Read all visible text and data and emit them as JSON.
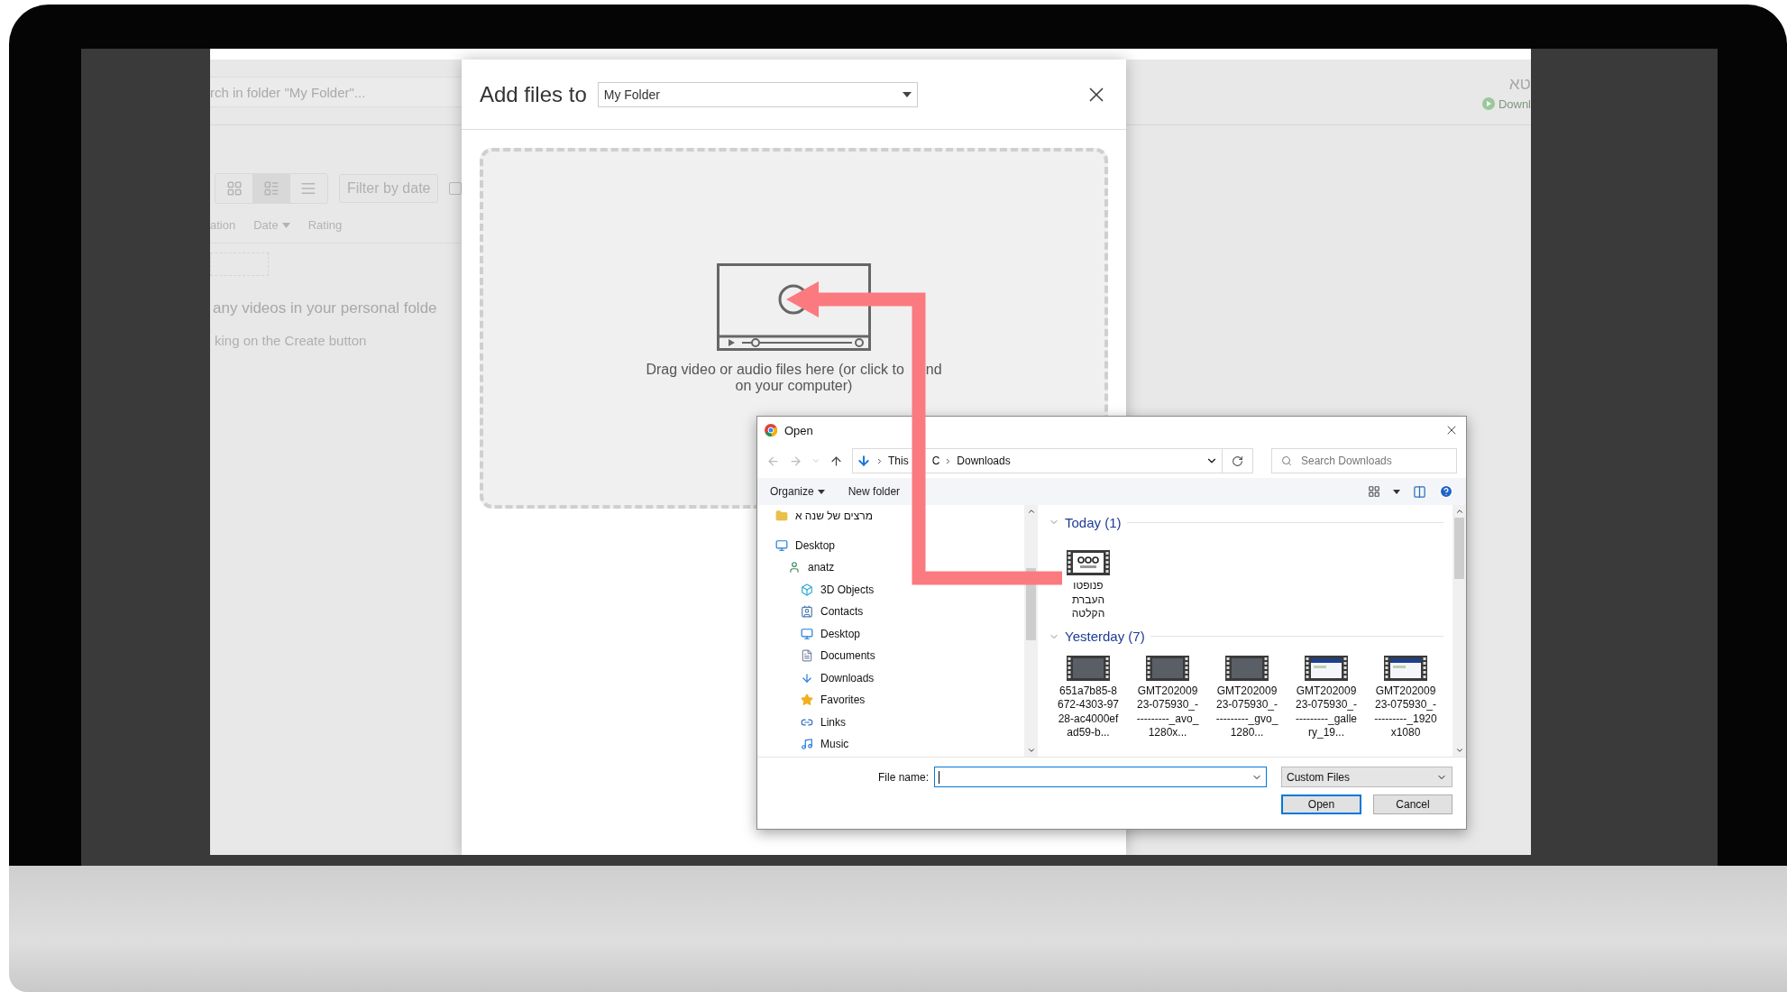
{
  "background_app": {
    "search": {
      "placeholder": "rch in folder \"My Folder\"..."
    },
    "view_buttons": [
      {
        "selected": false
      },
      {
        "selected": true
      },
      {
        "selected": false
      }
    ],
    "filter_button": "Filter by date",
    "checkbox": {
      "checked": false
    },
    "columns": [
      {
        "label": "ation",
        "sorted": false
      },
      {
        "label": "Date",
        "sorted": true
      },
      {
        "label": "Rating",
        "sorted": false
      }
    ],
    "empty_message": "any videos in your personal folde",
    "empty_hint": "king on the Create button",
    "user_name": "טא",
    "download_link": "Downl"
  },
  "add_files_modal": {
    "title": "Add files to",
    "folder_select": "My Folder",
    "dropzone": {
      "line_1_parts": [
        "Drag video or audio files here (or click to",
        "nd"
      ],
      "line_2": "on your computer)"
    }
  },
  "open_dialog": {
    "title": "Open",
    "breadcrumb": [
      [
        "This",
        "C"
      ],
      [
        "Downloads"
      ]
    ],
    "search": {
      "placeholder": "Search Downloads"
    },
    "toolbar": [
      {
        "label": "Organize",
        "menu": true
      },
      {
        "label": "New folder",
        "menu": false
      }
    ],
    "nav_tree": [
      {
        "label": "מרצים של שנה א"
      },
      {
        "label": "Desktop",
        "children": [
          {
            "label": "anatz",
            "children": [
              {
                "label": "3D Objects"
              },
              {
                "label": "Contacts"
              },
              {
                "label": "Desktop"
              },
              {
                "label": "Documents"
              },
              {
                "label": "Downloads"
              },
              {
                "label": "Favorites"
              },
              {
                "label": "Links"
              },
              {
                "label": "Music"
              }
            ]
          }
        ]
      }
    ],
    "groups": [
      {
        "label": "Today (1)",
        "files": [
          {
            "name": "פנופטו העברת הקלטה",
            "kind": "logo"
          }
        ]
      },
      {
        "label": "Yesterday (7)",
        "files": [
          {
            "name": "651a7b85-8672-4303-9728-ac4000efad59-b...",
            "kind": "photo"
          },
          {
            "name": "GMT20200923-075930_----------_avo_1280x...",
            "kind": "photo"
          },
          {
            "name": "GMT20200923-075930_----------_gvo_1280...",
            "kind": "photo"
          },
          {
            "name": "GMT20200923-075930_----------_gallery_19...",
            "kind": "screen"
          },
          {
            "name": "GMT20200923-075930_----------_1920x1080",
            "kind": "screen"
          }
        ]
      }
    ],
    "file_name_label": "File name:",
    "file_type": "Custom Files",
    "buttons": [
      {
        "label": "Open",
        "default": true
      },
      {
        "label": "Cancel",
        "default": false
      }
    ]
  }
}
